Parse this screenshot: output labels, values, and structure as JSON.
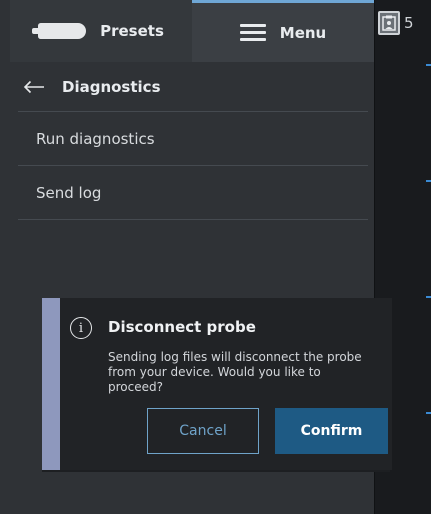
{
  "tabs": {
    "presets_label": "Presets",
    "menu_label": "Menu"
  },
  "right_panel": {
    "badge_count": "5"
  },
  "header": {
    "title": "Diagnostics"
  },
  "menu_items": [
    {
      "label": "Run diagnostics"
    },
    {
      "label": "Send log"
    }
  ],
  "dialog": {
    "title": "Disconnect probe",
    "body": "Sending log files will disconnect the probe from your device. Would you like to proceed?",
    "cancel_label": "Cancel",
    "confirm_label": "Confirm"
  },
  "colors": {
    "accent_blue": "#1e5a84",
    "outline_blue": "#6fa3c9",
    "dialog_accent": "#8e98bd",
    "panel_bg": "#2f3236"
  },
  "icons": [
    "probe-icon",
    "menu-icon",
    "clipboard-icon",
    "back-arrow-icon",
    "info-icon"
  ]
}
